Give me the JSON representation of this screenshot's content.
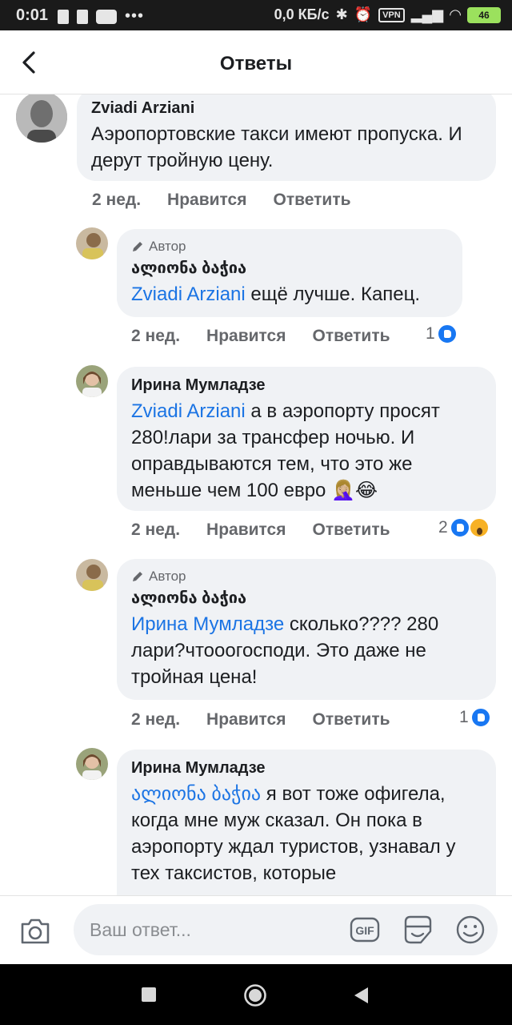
{
  "status_bar": {
    "time": "0:01",
    "dots": "•••",
    "speed": "0,0 КБ/с",
    "vpn": "VPN",
    "battery": "46"
  },
  "header": {
    "title": "Ответы"
  },
  "comments": [
    {
      "name": "Zviadi Arziani",
      "text": "Аэропортовские такси имеют пропуска. И дерут тройную цену.",
      "time": "2 нед.",
      "like": "Нравится",
      "reply": "Ответить"
    },
    {
      "author_badge": "Автор",
      "name": "ალიონა ბაჭია",
      "mention": "Zviadi Arziani",
      "text": " ещё лучше. Капец.",
      "time": "2 нед.",
      "like": "Нравится",
      "reply": "Ответить",
      "reaction_count": "1"
    },
    {
      "name": "Ирина Мумладзе",
      "mention": "Zviadi Arziani",
      "text": " а в аэропорту просят 280!лари за трансфер ночью. И оправдываются тем, что это же меньше чем 100 евро 🤦🏼‍♀️😂",
      "time": "2 нед.",
      "like": "Нравится",
      "reply": "Ответить",
      "reaction_count": "2"
    },
    {
      "author_badge": "Автор",
      "name": "ალიონა ბაჭია",
      "mention": "Ирина Мумладзе",
      "text": " сколько???? 280 лари?чтооогосподи. Это даже не тройная цена!",
      "time": "2 нед.",
      "like": "Нравится",
      "reply": "Ответить",
      "reaction_count": "1"
    },
    {
      "name": "Ирина Мумладзе",
      "mention": "ალიონა ბაჭია",
      "text": " я вот тоже офигела, когда мне муж сказал. Он пока в аэропорту ждал туристов, узнавал у тех таксистов, которые"
    }
  ],
  "composer": {
    "placeholder": "Ваш ответ...",
    "gif_label": "GIF"
  },
  "colors": {
    "accent": "#1b74e4",
    "bubble": "#f0f2f5",
    "like": "#1877f2"
  },
  "icons": [
    "back-arrow-icon",
    "camera-icon",
    "gif-icon",
    "sticker-icon",
    "emoji-icon",
    "pencil-icon",
    "like-reaction-icon",
    "wow-reaction-icon"
  ]
}
